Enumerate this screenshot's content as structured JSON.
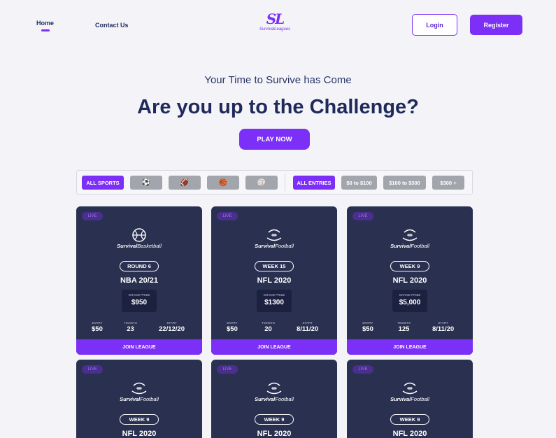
{
  "nav": {
    "home": "Home",
    "contact": "Contact Us",
    "logo_mark": "SL",
    "logo_word_a": "Survival",
    "logo_word_b": "Leagues",
    "login": "Login",
    "register": "Register"
  },
  "hero": {
    "subtitle": "Your Time to Survive has Come",
    "title": "Are you up to the Challenge?",
    "cta": "PLAY NOW"
  },
  "filters": {
    "sports": [
      {
        "label": "ALL SPORTS",
        "icon": "",
        "active": true
      },
      {
        "label": "",
        "icon": "⚽",
        "icon_name": "soccer-ball-icon",
        "active": false
      },
      {
        "label": "",
        "icon": "🏈",
        "icon_name": "american-football-icon",
        "active": false
      },
      {
        "label": "",
        "icon": "🏀",
        "icon_name": "basketball-icon",
        "active": false
      },
      {
        "label": "",
        "icon": "🏐",
        "icon_name": "volleyball-icon",
        "active": false
      }
    ],
    "entries": [
      {
        "label": "ALL ENTRIES",
        "active": true
      },
      {
        "label": "$0 to $100",
        "active": false
      },
      {
        "label": "$100 to $300",
        "active": false
      },
      {
        "label": "$300 +",
        "active": false
      }
    ]
  },
  "cards": [
    {
      "live": "LIVE",
      "brand_a": "Survival",
      "brand_b": "Basketball",
      "sport": "basketball",
      "round": "ROUND 6",
      "league": "NBA 20/21",
      "prize_label": "GRAND PRIZE",
      "prize": "$950",
      "entry_label": "ENTRY",
      "entry": "$50",
      "tickets_label": "TICKETS",
      "tickets": "23",
      "start_label": "START",
      "start": "22/12/20",
      "join": "JOIN LEAGUE"
    },
    {
      "live": "LIVE",
      "brand_a": "Survival",
      "brand_b": "Football",
      "sport": "football",
      "round": "WEEK 15",
      "league": "NFL 2020",
      "prize_label": "GRAND PRIZE",
      "prize": "$1300",
      "entry_label": "ENTRY",
      "entry": "$50",
      "tickets_label": "TICKETS",
      "tickets": "20",
      "start_label": "START",
      "start": "8/11/20",
      "join": "JOIN LEAGUE"
    },
    {
      "live": "LIVE",
      "brand_a": "Survival",
      "brand_b": "Football",
      "sport": "football",
      "round": "WEEK 9",
      "league": "NFL 2020",
      "prize_label": "GRAND PRIZE",
      "prize": "$5,000",
      "entry_label": "ENTRY",
      "entry": "$50",
      "tickets_label": "TICKETS",
      "tickets": "125",
      "start_label": "START",
      "start": "8/11/20",
      "join": "JOIN LEAGUE"
    },
    {
      "live": "LIVE",
      "brand_a": "Survival",
      "brand_b": "Football",
      "sport": "football",
      "round": "WEEK 9",
      "league": "NFL 2020"
    },
    {
      "live": "LIVE",
      "brand_a": "Survival",
      "brand_b": "Football",
      "sport": "football",
      "round": "WEEK 9",
      "league": "NFL 2020"
    },
    {
      "live": "LIVE",
      "brand_a": "Survival",
      "brand_b": "Football",
      "sport": "football",
      "round": "WEEK 9",
      "league": "NFL 2020"
    }
  ],
  "colors": {
    "accent": "#7b2ff7",
    "card_bg": "#2a3050",
    "text_dark": "#1f2a5c"
  }
}
